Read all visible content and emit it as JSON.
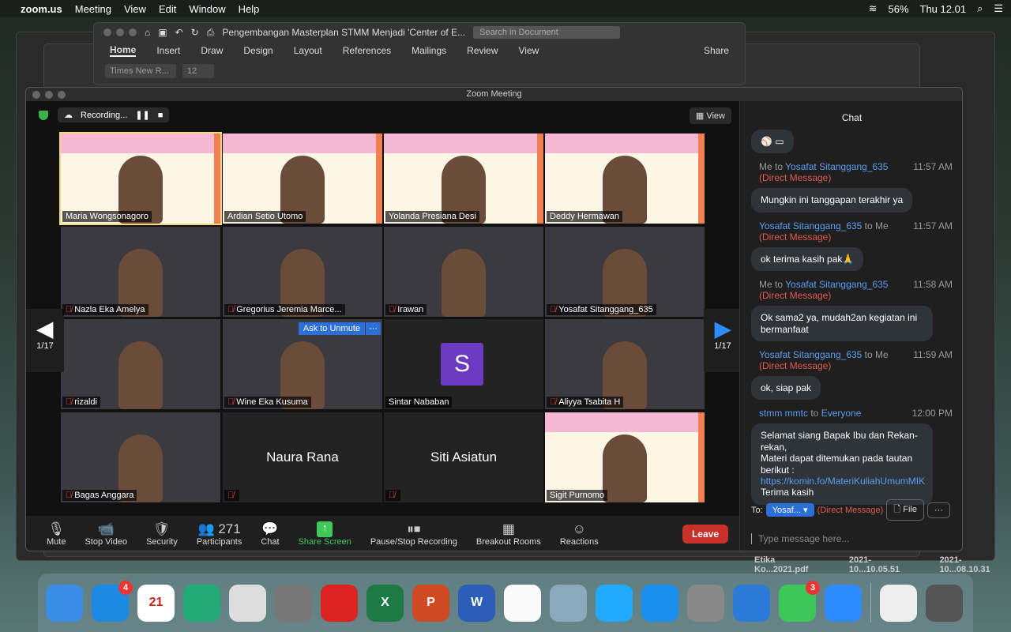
{
  "menubar": {
    "app": "zoom.us",
    "items": [
      "Meeting",
      "View",
      "Edit",
      "Window",
      "Help"
    ],
    "battery": "56%",
    "clock": "Thu 12.01"
  },
  "word": {
    "title": "Pengembangan Masterplan STMM Menjadi 'Center of E...",
    "search_placeholder": "Search in Document",
    "tabs": [
      "Home",
      "Insert",
      "Draw",
      "Design",
      "Layout",
      "References",
      "Mailings",
      "Review",
      "View"
    ],
    "share": "Share",
    "font": "Times New R...",
    "size": "12"
  },
  "zoom": {
    "window_title": "Zoom Meeting",
    "recording": "Recording...",
    "view": "View",
    "page": "1/17",
    "tiles": [
      {
        "name": "Maria Wongsonagoro",
        "type": "slide",
        "muted": false,
        "active": true
      },
      {
        "name": "Ardian Setio Utomo",
        "type": "slide",
        "muted": false
      },
      {
        "name": "Yolanda Presiana Desi",
        "type": "slide",
        "muted": false
      },
      {
        "name": "Deddy Hermawan",
        "type": "slide",
        "muted": false
      },
      {
        "name": "Nazla Eka Amelya",
        "type": "video",
        "muted": true
      },
      {
        "name": "Gregorius Jeremia Marce...",
        "type": "video",
        "muted": true
      },
      {
        "name": "Irawan",
        "type": "video",
        "muted": true
      },
      {
        "name": "Yosafat Sitanggang_635",
        "type": "video",
        "muted": true
      },
      {
        "name": "rizaldi",
        "type": "video",
        "muted": true
      },
      {
        "name": "Wine Eka Kusuma",
        "type": "video",
        "muted": true,
        "ask": "Ask to Unmute"
      },
      {
        "name": "Sintar Nababan",
        "type": "avatar",
        "initial": "S",
        "muted": false
      },
      {
        "name": "Aliyya Tsabita H",
        "type": "video",
        "muted": true
      },
      {
        "name": "Bagas Anggara",
        "type": "video",
        "muted": true
      },
      {
        "name": "Naura Rana",
        "type": "name",
        "muted": true
      },
      {
        "name": "Siti Asiatun",
        "type": "name",
        "muted": true
      },
      {
        "name": "Sigit Purnomo",
        "type": "slide",
        "muted": false
      }
    ],
    "toolbar": [
      {
        "label": "Mute",
        "icon": "🎙"
      },
      {
        "label": "Stop Video",
        "icon": "📹"
      },
      {
        "label": "Security",
        "icon": "🛡"
      },
      {
        "label": "Participants",
        "icon": "👥 271"
      },
      {
        "label": "Chat",
        "icon": "💬"
      },
      {
        "label": "Share Screen",
        "icon": "↑"
      },
      {
        "label": "Pause/Stop Recording",
        "icon": "⏸⏹"
      },
      {
        "label": "Breakout Rooms",
        "icon": "▦"
      },
      {
        "label": "Reactions",
        "icon": "☺"
      }
    ],
    "leave": "Leave"
  },
  "chat": {
    "title": "Chat",
    "messages": [
      {
        "from": "Me",
        "to": "Yosafat Sitanggang_635",
        "dm": "(Direct Message)",
        "time": "11:57 AM",
        "text": "Mungkin ini tanggapan terakhir ya"
      },
      {
        "from": "Yosafat Sitanggang_635",
        "to": "Me",
        "dm": "(Direct Message)",
        "time": "11:57 AM",
        "text": "ok terima kasih pak🙏"
      },
      {
        "from": "Me",
        "to": "Yosafat Sitanggang_635",
        "dm": "(Direct Message)",
        "time": "11:58 AM",
        "text": "Ok sama2 ya, mudah2an kegiatan ini bermanfaat"
      },
      {
        "from": "Yosafat Sitanggang_635",
        "to": "Me",
        "dm": "(Direct Message)",
        "time": "11:59 AM",
        "text": "ok, siap pak"
      },
      {
        "from": "stmm mmtc",
        "to": "Everyone",
        "dm": "",
        "time": "12:00 PM",
        "text": "Selamat siang Bapak Ibu dan Rekan-rekan,\nMateri dapat ditemukan pada tautan berikut : ",
        "link": "https://komin.fo/MateriKuliahUmumMIK",
        "after": "Terima kasih"
      }
    ],
    "to_label": "To:",
    "recipient": "Yosaf...",
    "dm": "(Direct Message)",
    "file": "File",
    "more": "···",
    "placeholder": "Type message here..."
  },
  "desktop_files": [
    "Etika Ko...2021.pdf",
    "2021-10...10.05.51",
    "2021-10...08.10.31"
  ],
  "dock": [
    {
      "name": "finder",
      "color": "#3a8ee6"
    },
    {
      "name": "app-store",
      "color": "#1e88e5",
      "badge": "4"
    },
    {
      "name": "calendar",
      "color": "#fff",
      "label": "21"
    },
    {
      "name": "safari-alt",
      "color": "#2a7"
    },
    {
      "name": "chrome",
      "color": "#ddd"
    },
    {
      "name": "launchpad",
      "color": "#777"
    },
    {
      "name": "mendeley",
      "color": "#d22"
    },
    {
      "name": "excel",
      "color": "#1d7a45",
      "label": "X"
    },
    {
      "name": "powerpoint",
      "color": "#d04a24",
      "label": "P"
    },
    {
      "name": "word",
      "color": "#2b5eb8",
      "label": "W"
    },
    {
      "name": "photos",
      "color": "#fafafa"
    },
    {
      "name": "preview",
      "color": "#8ab"
    },
    {
      "name": "quicktime",
      "color": "#2af"
    },
    {
      "name": "safari",
      "color": "#1a8ff0"
    },
    {
      "name": "system-preferences",
      "color": "#888"
    },
    {
      "name": "app",
      "color": "#2d7bd8"
    },
    {
      "name": "whatsapp",
      "color": "#3cc659",
      "badge": "3"
    },
    {
      "name": "zoom",
      "color": "#2d8cff"
    },
    {
      "name": "document",
      "color": "#eee"
    },
    {
      "name": "trash",
      "color": "#555"
    }
  ]
}
